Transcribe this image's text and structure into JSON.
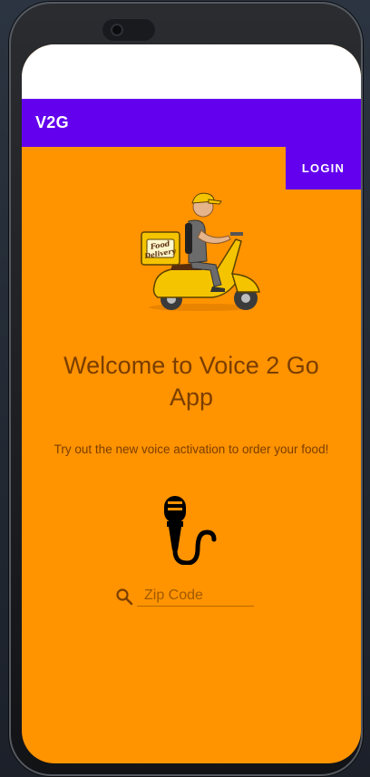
{
  "app_bar": {
    "title": "V2G"
  },
  "toolbar": {
    "login_label": "LOGIN"
  },
  "hero": {
    "icon": "food-delivery-scooter-illustration",
    "badge_line1": "Food",
    "badge_line2": "Delivery"
  },
  "main": {
    "welcome_title": "Welcome to Voice 2 Go App",
    "subtitle": "Try out the new voice activation to order your food!",
    "mic_icon": "microphone-icon"
  },
  "search": {
    "placeholder": "Zip Code",
    "value": "",
    "icon": "search-icon"
  },
  "colors": {
    "primary": "#6300ee",
    "background": "#ff9300",
    "text": "#7a3e00",
    "status_bar": "#ffffff"
  }
}
